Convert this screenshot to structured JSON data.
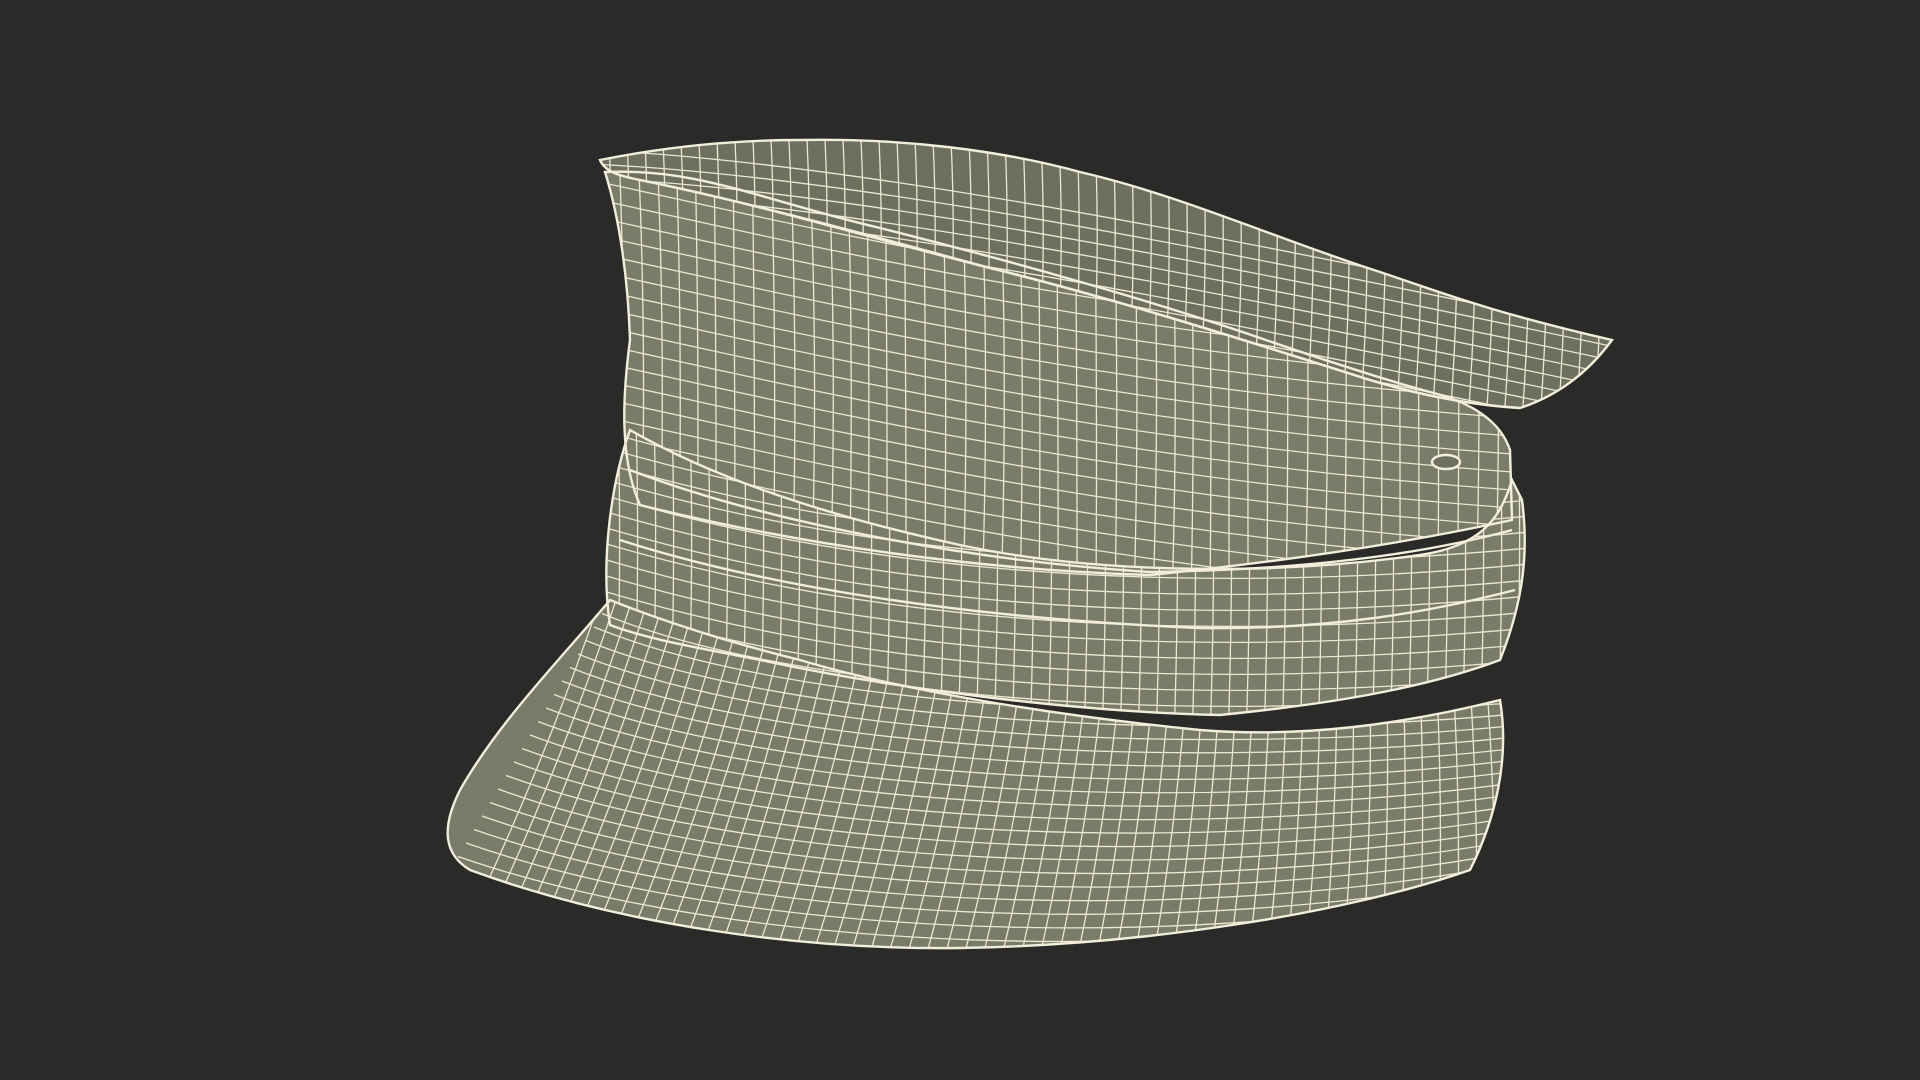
{
  "scene": {
    "subject": "cap-wireframe-render",
    "colors": {
      "background": "#2a2a28",
      "surface": "#7a7c6a",
      "surface_shade": "#6e705f",
      "wire": "#ece8d2",
      "outline": "#f2eedb"
    }
  }
}
